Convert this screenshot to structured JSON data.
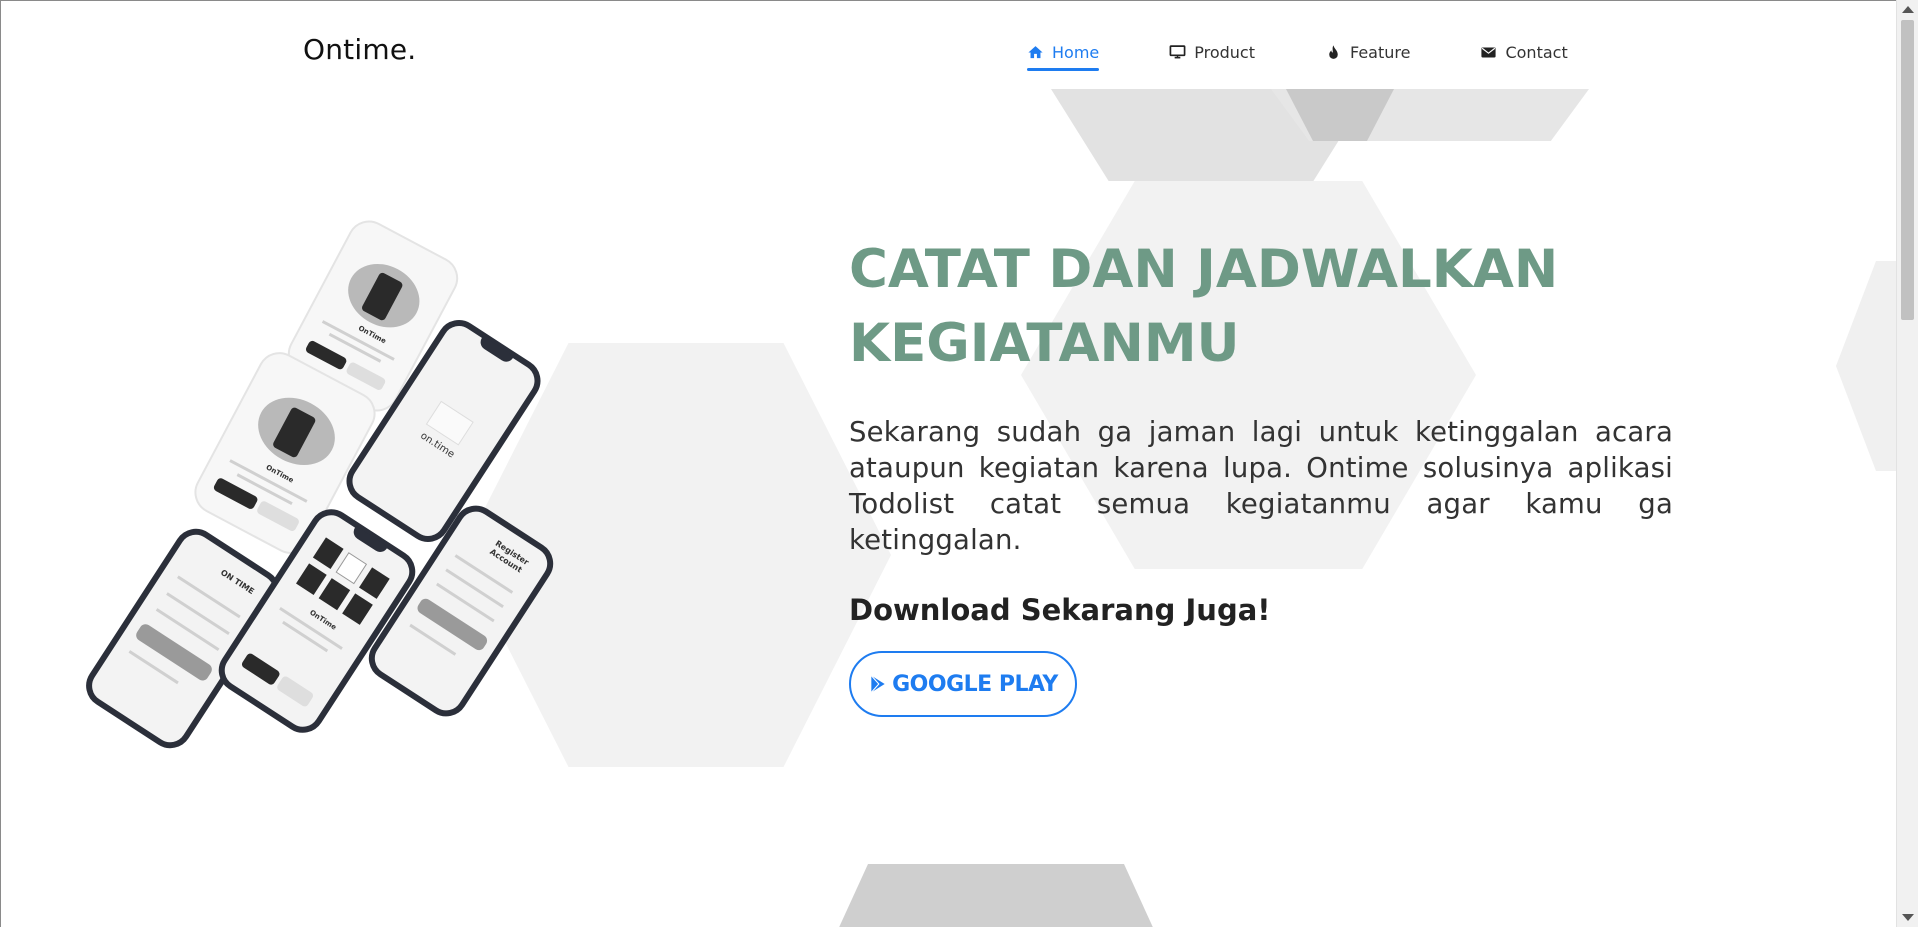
{
  "brand": "Ontime.",
  "nav": {
    "items": [
      {
        "label": "Home",
        "icon": "home-icon",
        "active": true
      },
      {
        "label": "Product",
        "icon": "monitor-icon",
        "active": false
      },
      {
        "label": "Feature",
        "icon": "fire-icon",
        "active": false
      },
      {
        "label": "Contact",
        "icon": "envelope-icon",
        "active": false
      }
    ]
  },
  "hero": {
    "headline_line1": "CATAT DAN JADWALKAN",
    "headline_line2": "KEGIATANMU",
    "description": "Sekarang sudah ga jaman lagi untuk ketinggalan acara ataupun kegiatan karena lupa. Ontime solusinya aplikasi Todolist catat semua kegiatanmu agar kamu ga ketinggalan.",
    "cta_title": "Download Sekarang Juga!",
    "store_button": "GOOGLE PLAY"
  },
  "mockups": {
    "login_title": "ON TIME",
    "register_title": "Register Account",
    "splash_text": "on.time",
    "app_name": "OnTime"
  },
  "colors": {
    "accent": "#1e7cf0",
    "headline": "#6e9a86",
    "text": "#333333",
    "phone_frame": "#2b2f3a"
  }
}
